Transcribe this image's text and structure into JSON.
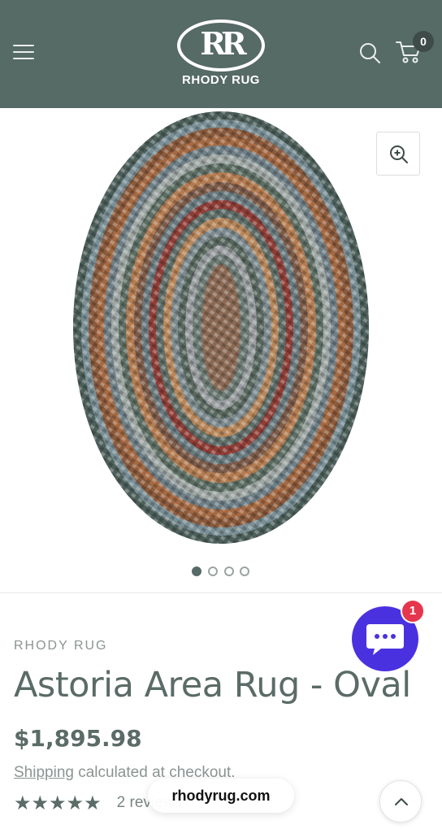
{
  "header": {
    "logo_monogram": "RR",
    "logo_text": "RHODY RUG",
    "menu_icon": "hamburger-menu-icon",
    "search_icon": "search-icon",
    "cart_icon": "cart-icon",
    "cart_count": "0",
    "background_color": "#566a66"
  },
  "gallery": {
    "zoom_icon": "zoom-in-icon",
    "image_count": 4,
    "active_index": 0
  },
  "product": {
    "vendor": "RHODY RUG",
    "title": "Astoria Area Rug - Oval",
    "price": "$1,895.98",
    "shipping_link": "Shipping",
    "shipping_text": " calculated at checkout.",
    "rating_stars": "★★★★★",
    "reviews_text": "2 reviews"
  },
  "chat": {
    "icon": "chat-bubble-icon",
    "badge_count": "1",
    "color": "#4a31e0"
  },
  "browser": {
    "url": "rhodyrug.com"
  },
  "scroll_top_icon": "chevron-up-icon"
}
